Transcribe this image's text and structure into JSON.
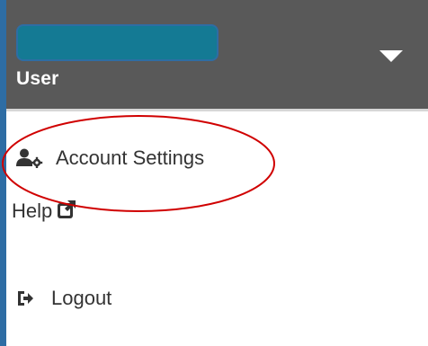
{
  "header": {
    "user_label": "User",
    "pill_color": "#147a94",
    "background": "#595959"
  },
  "menu": {
    "items": [
      {
        "label": "Account Settings",
        "icon": "user-gear-icon"
      },
      {
        "label": "Help",
        "icon": "external-link-icon"
      },
      {
        "label": "Logout",
        "icon": "sign-out-icon"
      }
    ]
  },
  "annotation": {
    "shape": "ellipse",
    "color": "#d00000",
    "target": "Account Settings"
  }
}
